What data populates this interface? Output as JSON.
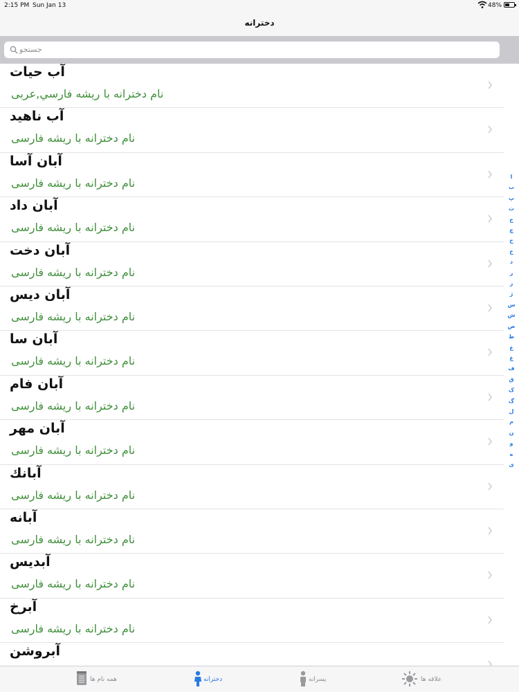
{
  "status_bar": {
    "time": "2:15 PM",
    "date": "Sun Jan 13",
    "battery": "48%"
  },
  "nav": {
    "title": "دخترانه"
  },
  "search": {
    "placeholder": "جستجو"
  },
  "rows": [
    {
      "name": "آب حيات",
      "origin": "نام دخترانه با ريشه فارسي,عربى"
    },
    {
      "name": "آب ناهيد",
      "origin": "نام دخترانه با ريشه فارسی"
    },
    {
      "name": "آبان آسا",
      "origin": "نام دخترانه با ريشه فارسی"
    },
    {
      "name": "آبان داد",
      "origin": "نام دخترانه با ريشه فارسی"
    },
    {
      "name": "آبان دخت",
      "origin": "نام دخترانه با ريشه فارسی"
    },
    {
      "name": "آبان ديس",
      "origin": "نام دخترانه با ريشه فارسی"
    },
    {
      "name": "آبان سا",
      "origin": "نام دخترانه با ريشه فارسی"
    },
    {
      "name": "آبان فام",
      "origin": "نام دخترانه با ريشه فارسی"
    },
    {
      "name": "آبان مهر",
      "origin": "نام دخترانه با ريشه فارسی"
    },
    {
      "name": "آبانك",
      "origin": "نام دخترانه با ريشه فارسی"
    },
    {
      "name": "آبانه",
      "origin": "نام دخترانه با ريشه فارسی"
    },
    {
      "name": "آبديس",
      "origin": "نام دخترانه با ريشه فارسی"
    },
    {
      "name": "آبرخ",
      "origin": "نام دخترانه با ريشه فارسی"
    },
    {
      "name": "آبروشن",
      "origin": ""
    }
  ],
  "index_letters": [
    "ا",
    "ب",
    "پ",
    "ت",
    "ج",
    "چ",
    "ح",
    "خ",
    "د",
    "ر",
    "ز",
    "ژ",
    "س",
    "ش",
    "ص",
    "ط",
    "ع",
    "غ",
    "ف",
    "ق",
    "ک",
    "گ",
    "ل",
    "م",
    "ن",
    "و",
    "ه",
    "ی"
  ],
  "tabs": [
    {
      "label": "همه نام ها",
      "icon": "list-document-icon"
    },
    {
      "label": "دخترانه",
      "icon": "girl-icon"
    },
    {
      "label": "پسرانه",
      "icon": "boy-icon"
    },
    {
      "label": "علاقه ها",
      "icon": "sun-icon"
    }
  ],
  "colors": {
    "accent": "#2a7ae2",
    "origin_text": "#3f8f3a"
  }
}
